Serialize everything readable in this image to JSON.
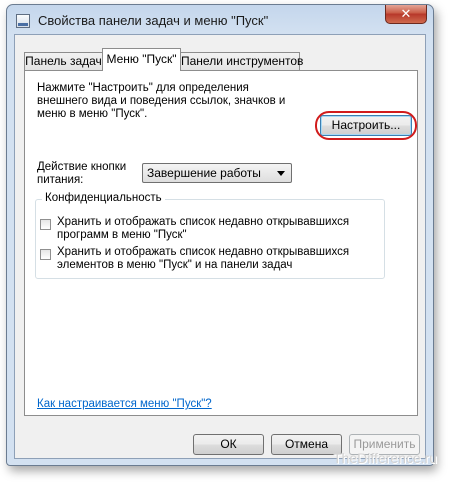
{
  "window": {
    "title": "Свойства панели задач и меню \"Пуск\"",
    "close_glyph": "✕"
  },
  "tabs": [
    {
      "label": "Панель задач",
      "active": false
    },
    {
      "label": "Меню \"Пуск\"",
      "active": true
    },
    {
      "label": "Панели инструментов",
      "active": false
    }
  ],
  "start_menu": {
    "description": "Нажмите \"Настроить\" для определения внешнего вида и поведения ссылок, значков и меню в меню \"Пуск\".",
    "customize_button": "Настроить...",
    "power_label": "Действие кнопки питания:",
    "power_select_value": "Завершение работы",
    "privacy": {
      "title": "Конфиденциальность",
      "options": [
        {
          "label": "Хранить и отображать список недавно открывавшихся программ в меню \"Пуск\"",
          "checked": false
        },
        {
          "label": "Хранить и отображать список недавно открывавшихся элементов в меню \"Пуск\" и на панели задач",
          "checked": false
        }
      ]
    },
    "help_link": "Как настраивается меню \"Пуск\"?"
  },
  "footer": {
    "ok": "ОК",
    "cancel": "Отмена",
    "apply": "Применить"
  },
  "watermark": "TheDifference.ru",
  "colors": {
    "highlight": "#d11c1c",
    "link": "#0066cc"
  }
}
